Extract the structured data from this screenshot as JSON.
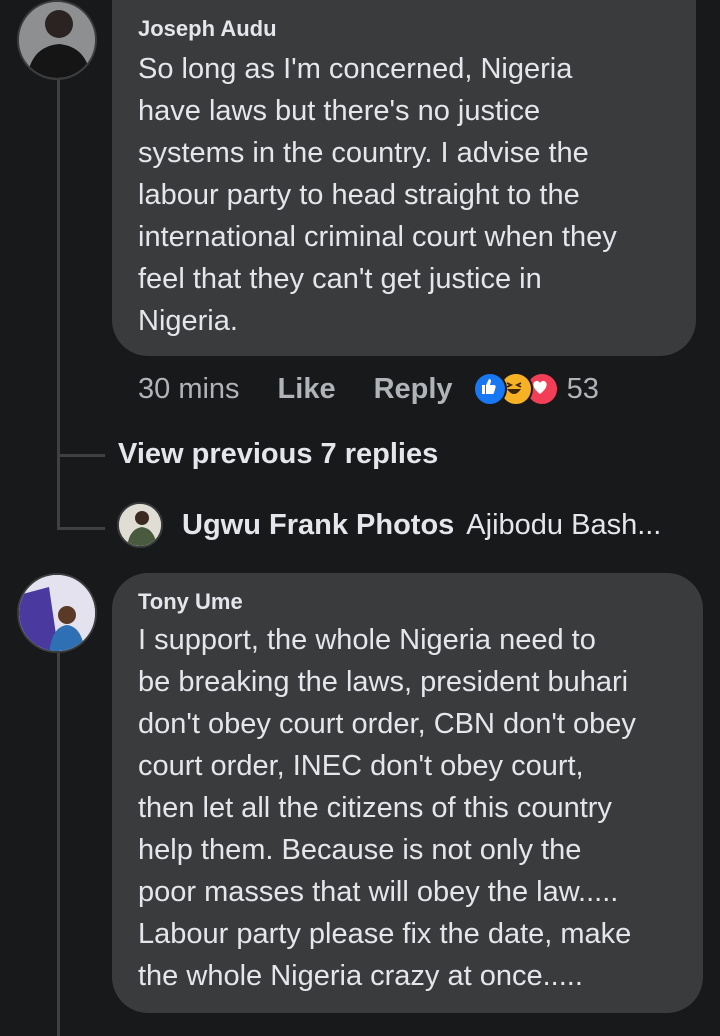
{
  "comment1": {
    "author": "Joseph Audu",
    "text": "So long as I'm concerned, Nigeria\nhave laws but there's no justice\nsystems in the country. I advise the\nlabour party to head straight to the\ninternational criminal court when they\nfeel that they can't get justice in\nNigeria.",
    "time": "30 mins",
    "like_label": "Like",
    "reply_label": "Reply",
    "reaction_count": "53",
    "reactions": [
      "like-icon",
      "haha-icon",
      "love-icon"
    ]
  },
  "view_previous_label": "View previous 7 replies",
  "reply_preview": {
    "name": "Ugwu Frank Photos",
    "snippet": "Ajibodu Bash..."
  },
  "comment2": {
    "author": "Tony Ume",
    "text": "I support, the whole Nigeria need to\nbe breaking the laws, president buhari\ndon't obey court order, CBN don't obey\ncourt order, INEC don't obey court,\nthen let all the citizens of this country\nhelp them. Because is not only the\npoor masses that will obey the law.....\nLabour party please fix the date, make\nthe whole Nigeria crazy at once....."
  },
  "colors": {
    "background": "#18191a",
    "bubble": "#3a3b3c",
    "like_blue": "#1877f2",
    "haha_yellow": "#f7b125",
    "love_red": "#f33e58"
  }
}
